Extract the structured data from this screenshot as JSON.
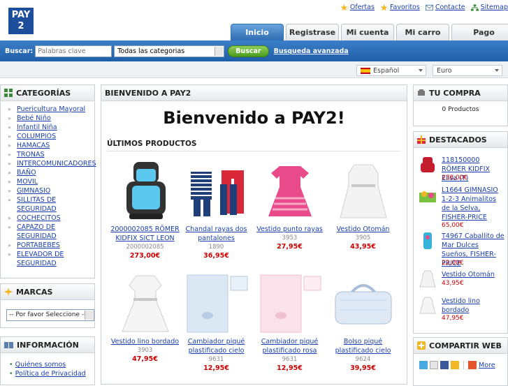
{
  "logo": {
    "line1": "PAY",
    "line2": "2"
  },
  "toplinks": [
    {
      "label": "Ofertas",
      "icon": "star-icon"
    },
    {
      "label": "Favoritos",
      "icon": "star-icon"
    },
    {
      "label": "Contacte",
      "icon": "mail-icon"
    },
    {
      "label": "Sitemap",
      "icon": "sitemap-icon"
    }
  ],
  "tabs": [
    {
      "label": "Inicio",
      "active": true
    },
    {
      "label": "Registrase",
      "active": false
    },
    {
      "label": "Mi cuenta",
      "active": false
    },
    {
      "label": "Mi carro",
      "active": false
    },
    {
      "label": "Pago",
      "active": false
    }
  ],
  "search": {
    "label": "Buscar:",
    "placeholder": "Palabras clave",
    "category": "Todas las categorias",
    "button": "Buscar",
    "advanced": "Busqueda avanzada"
  },
  "settings": {
    "language": "Español",
    "currency": "Euro"
  },
  "categories": {
    "title": "CATEGORÍAS",
    "items": [
      "Puericultura Mayoral",
      "Bebé Niño",
      "Infantil Niña",
      "COLUMPIOS",
      "HAMACAS",
      "TRONAS",
      "INTERCOMUNICADORES",
      "BAÑO",
      "MOVIL",
      "GIMNASIO",
      "SILLITAS DE SEGURIDAD",
      "COCHECITOS",
      "CAPAZO DE SEGURIDAD",
      "PORTABEBES",
      "ELEVADOR DE SEGURIDAD"
    ]
  },
  "brands": {
    "title": "MARCAS",
    "select": "-- Por favor Seleccione --"
  },
  "info": {
    "title": "INFORMACIÓN",
    "items": [
      "Quiénes somos",
      "Política de Privacidad"
    ]
  },
  "welcome": {
    "header": "BIENVENIDO A PAY2",
    "title": "Bienvenido a PAY2!",
    "latest": "ÚLTIMOS PRODUCTOS"
  },
  "products": [
    {
      "name": "2000002085 RÖMER KIDFIX SICT LEON",
      "code": "2000002085",
      "price": "273,00€"
    },
    {
      "name": "Chandal rayas dos pantalones",
      "code": "1890",
      "price": "36,95€"
    },
    {
      "name": "Vestido punto rayas",
      "code": "3953",
      "price": "27,95€"
    },
    {
      "name": "Vestido Otomán",
      "code": "3905",
      "price": "43,95€"
    },
    {
      "name": "Vestido lino bordado",
      "code": "3903",
      "price": "47,95€"
    },
    {
      "name": "Cambiador piqué plastificado cielo",
      "code": "9631",
      "price": "12,95€"
    },
    {
      "name": "Cambiador piqué plastificado rosa",
      "code": "9631",
      "price": "12,95€"
    },
    {
      "name": "Bolso piqué plastificado cielo",
      "code": "9624",
      "price": "39,95€"
    }
  ],
  "cart": {
    "title": "TU COMPRA",
    "text": "0 Productos"
  },
  "featured": {
    "title": "DESTACADOS",
    "items": [
      {
        "name": "118150000 RÖMER KIDFIX Elisa (T)",
        "price": "238,00€"
      },
      {
        "name": "L1664 GIMNASIO 1-2-3 Animalitos de la Selva, FISHER-PRICE",
        "price": "65,00€"
      },
      {
        "name": "T4967 Caballito de Mar Dulces Sueños, FISHER-PRICE",
        "price": "22,00€"
      },
      {
        "name": "Vestido Otomán",
        "price": "43,95€"
      },
      {
        "name": "Vestido lino bordado",
        "price": "47,95€"
      }
    ]
  },
  "share": {
    "title": "COMPARTIR WEB",
    "more": "More"
  },
  "colors": {
    "brand": "#1c4e9c",
    "bar": "#2f6db2",
    "price": "#cc0000"
  }
}
